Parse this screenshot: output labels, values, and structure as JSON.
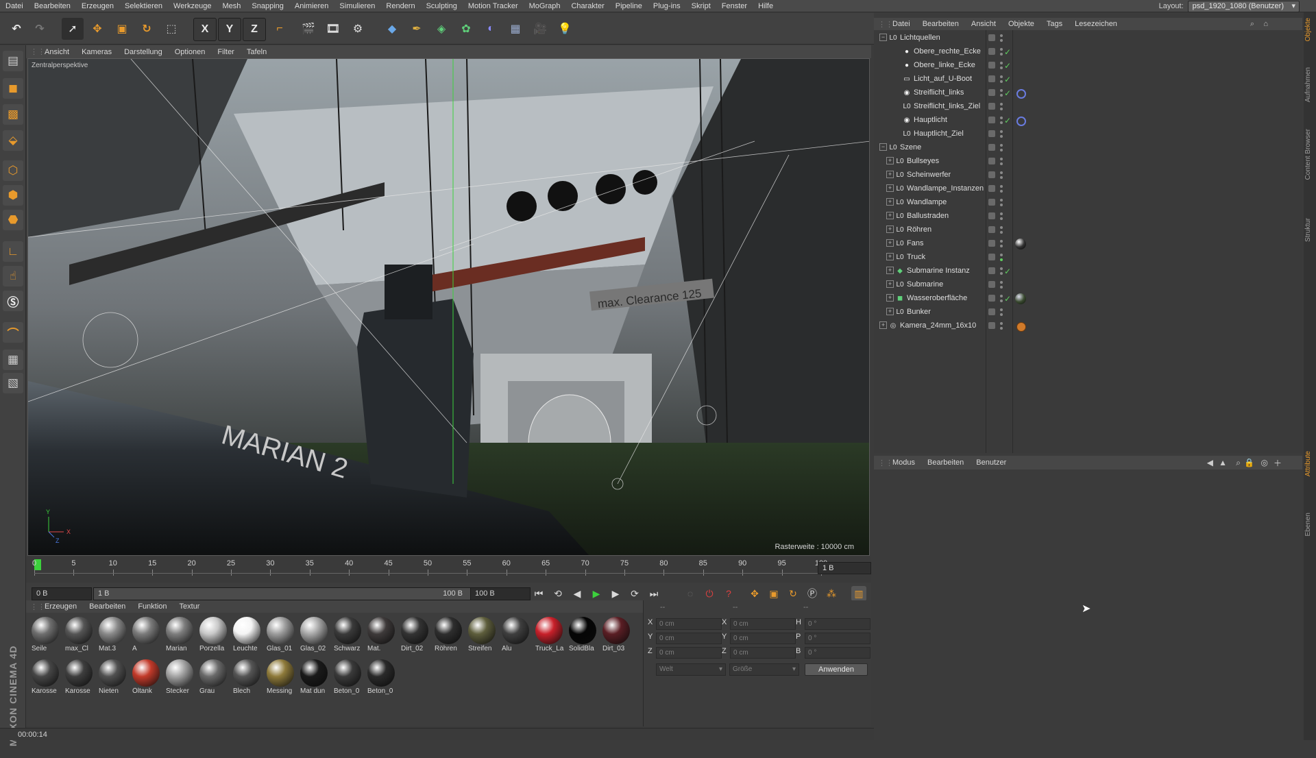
{
  "menubar": {
    "items": [
      "Datei",
      "Bearbeiten",
      "Erzeugen",
      "Selektieren",
      "Werkzeuge",
      "Mesh",
      "Snapping",
      "Animieren",
      "Simulieren",
      "Rendern",
      "Sculpting",
      "Motion Tracker",
      "MoGraph",
      "Charakter",
      "Pipeline",
      "Plug-ins",
      "Skript",
      "Fenster",
      "Hilfe"
    ],
    "layout_label": "Layout:",
    "layout_value": "psd_1920_1080 (Benutzer)"
  },
  "toolbar": {
    "axis_x": "X",
    "axis_y": "Y",
    "axis_z": "Z",
    "icons": [
      "undo-icon",
      "redo-icon",
      "select-icon",
      "move-icon",
      "scale-icon",
      "rotate-icon",
      "live-select-icon",
      "axis-x",
      "axis-y",
      "axis-z",
      "coord-system-icon",
      "render-view-icon",
      "render-picture-queue-icon",
      "render-settings-icon",
      "cube-icon",
      "pen-icon",
      "subdivision-icon",
      "cloner-icon",
      "deformer-icon",
      "floor-icon",
      "camera-icon",
      "light-icon"
    ]
  },
  "viewport": {
    "menu": [
      "Ansicht",
      "Kameras",
      "Darstellung",
      "Optionen",
      "Filter",
      "Tafeln"
    ],
    "camera_label": "Zentralperspektive",
    "grid_label": "Rasterweite : 10000 cm",
    "scene_text": "MARIAN 2",
    "sign_text": "max. Clearance 125",
    "axis": {
      "x": "X",
      "y": "Y",
      "z": "Z"
    }
  },
  "timeline": {
    "ticks": [
      "0",
      "5",
      "10",
      "15",
      "20",
      "25",
      "30",
      "35",
      "40",
      "45",
      "50",
      "55",
      "60",
      "65",
      "70",
      "75",
      "80",
      "85",
      "90",
      "95",
      "100"
    ],
    "current_frame": "1 B"
  },
  "transport": {
    "start_field": "0 B",
    "range_start": "1 B",
    "range_end": "100 B",
    "end_field": "100 B"
  },
  "materials": {
    "menu": [
      "Erzeugen",
      "Bearbeiten",
      "Funktion",
      "Textur"
    ],
    "row1": [
      {
        "name": "Seile",
        "color": "#6f6f6f"
      },
      {
        "name": "max_Cl",
        "color": "#555555"
      },
      {
        "name": "Mat.3",
        "color": "#8a8a8a"
      },
      {
        "name": "A",
        "color": "#7b7b7b"
      },
      {
        "name": "Marian",
        "color": "#7d7d7d"
      },
      {
        "name": "Porzella",
        "color": "#c9c9c9"
      },
      {
        "name": "Leuchte",
        "color": "#f4f4f4"
      },
      {
        "name": "Glas_01",
        "color": "#9c9c9c"
      },
      {
        "name": "Glas_02",
        "color": "#a8a8a8"
      },
      {
        "name": "Schwarz",
        "color": "#3a3a3a"
      },
      {
        "name": "Mat.",
        "color": "#3e3a3a"
      },
      {
        "name": "Dirt_02",
        "color": "#333333"
      },
      {
        "name": "Röhren",
        "color": "#2e2e2e"
      },
      {
        "name": "Streifen",
        "color": "#5e5e3c"
      },
      {
        "name": "Alu",
        "color": "#3f3f3f"
      },
      {
        "name": "Truck_La",
        "color": "#c8202a"
      },
      {
        "name": "SolidBla",
        "color": "#050505"
      },
      {
        "name": "Dirt_03",
        "color": "#5a1e24"
      }
    ],
    "row2": [
      {
        "name": "Karosse",
        "color": "#464646"
      },
      {
        "name": "Karosse",
        "color": "#3e3e3e"
      },
      {
        "name": "Nieten",
        "color": "#505050"
      },
      {
        "name": "Öltank",
        "color": "#c23a2a"
      },
      {
        "name": "Stecker",
        "color": "#a4a4a4"
      },
      {
        "name": "Grau",
        "color": "#6a6a6a"
      },
      {
        "name": "Blech",
        "color": "#555555"
      },
      {
        "name": "Messing",
        "color": "#8e7a3a"
      },
      {
        "name": "Mat dun",
        "color": "#1a1a1a"
      },
      {
        "name": "Beton_0",
        "color": "#3a3a3a"
      },
      {
        "name": "Beton_0",
        "color": "#2a2a2a"
      }
    ]
  },
  "coordinates": {
    "header": [
      "--",
      "--",
      "--"
    ],
    "rows": [
      {
        "l1": "X",
        "v1": "0 cm",
        "l2": "X",
        "v2": "0 cm",
        "l3": "H",
        "v3": "0 °"
      },
      {
        "l1": "Y",
        "v1": "0 cm",
        "l2": "Y",
        "v2": "0 cm",
        "l3": "P",
        "v3": "0 °"
      },
      {
        "l1": "Z",
        "v1": "0 cm",
        "l2": "Z",
        "v2": "0 cm",
        "l3": "B",
        "v3": "0 °"
      }
    ],
    "mode1": "Welt",
    "mode2": "Größe",
    "apply_label": "Anwenden"
  },
  "status": {
    "time": "00:00:14"
  },
  "object_manager": {
    "menu": [
      "Datei",
      "Bearbeiten",
      "Ansicht",
      "Objekte",
      "Tags",
      "Lesezeichen"
    ],
    "objects": [
      {
        "name": "Lichtquellen",
        "indent": 0,
        "expanded": true,
        "icon": "null-icon",
        "check": false,
        "tag": ""
      },
      {
        "name": "Obere_rechte_Ecke",
        "indent": 2,
        "expanded": false,
        "icon": "light-icon",
        "check": true,
        "tag": ""
      },
      {
        "name": "Obere_linke_Ecke",
        "indent": 2,
        "expanded": false,
        "icon": "light-icon",
        "check": true,
        "tag": ""
      },
      {
        "name": "Licht_auf_U-Boot",
        "indent": 2,
        "expanded": false,
        "icon": "area-light-icon",
        "check": true,
        "tag": ""
      },
      {
        "name": "Streiflicht_links",
        "indent": 2,
        "expanded": false,
        "icon": "spot-light-icon",
        "check": true,
        "tag": "target"
      },
      {
        "name": "Streiflicht_links_Ziel",
        "indent": 2,
        "expanded": false,
        "icon": "null-icon",
        "check": false,
        "tag": ""
      },
      {
        "name": "Hauptlicht",
        "indent": 2,
        "expanded": false,
        "icon": "spot-light-icon",
        "check": true,
        "tag": "target"
      },
      {
        "name": "Hauptlicht_Ziel",
        "indent": 2,
        "expanded": false,
        "icon": "null-icon",
        "check": false,
        "tag": ""
      },
      {
        "name": "Szene",
        "indent": 0,
        "expanded": true,
        "icon": "null-icon",
        "check": false,
        "tag": ""
      },
      {
        "name": "Bullseyes",
        "indent": 1,
        "expanded": false,
        "icon": "null-icon",
        "check": false,
        "tag": ""
      },
      {
        "name": "Scheinwerfer",
        "indent": 1,
        "expanded": false,
        "icon": "null-icon",
        "check": false,
        "tag": ""
      },
      {
        "name": "Wandlampe_Instanzen",
        "indent": 1,
        "expanded": false,
        "icon": "null-icon",
        "check": false,
        "tag": ""
      },
      {
        "name": "Wandlampe",
        "indent": 1,
        "expanded": false,
        "icon": "null-icon",
        "check": false,
        "tag": ""
      },
      {
        "name": "Ballustraden",
        "indent": 1,
        "expanded": false,
        "icon": "null-icon",
        "check": false,
        "tag": ""
      },
      {
        "name": "Röhren",
        "indent": 1,
        "expanded": false,
        "icon": "null-icon",
        "check": false,
        "tag": ""
      },
      {
        "name": "Fans",
        "indent": 1,
        "expanded": false,
        "icon": "null-icon",
        "check": false,
        "tag": "material"
      },
      {
        "name": "Truck",
        "indent": 1,
        "expanded": false,
        "icon": "null-icon",
        "check": false,
        "tag": "green-dot"
      },
      {
        "name": "Submarine Instanz",
        "indent": 1,
        "expanded": false,
        "icon": "instance-icon",
        "check": true,
        "tag": ""
      },
      {
        "name": "Submarine",
        "indent": 1,
        "expanded": false,
        "icon": "null-icon",
        "check": false,
        "tag": ""
      },
      {
        "name": "Wasseroberfläche",
        "indent": 1,
        "expanded": false,
        "icon": "plane-icon",
        "check": true,
        "tag": "material-green"
      },
      {
        "name": "Bunker",
        "indent": 1,
        "expanded": false,
        "icon": "null-icon",
        "check": false,
        "tag": ""
      },
      {
        "name": "Kamera_24mm_16x10",
        "indent": 0,
        "expanded": false,
        "icon": "camera-icon",
        "check": false,
        "tag": "protection"
      }
    ]
  },
  "attribute_manager": {
    "menu": [
      "Modus",
      "Bearbeiten",
      "Benutzer"
    ]
  },
  "right_tabs": [
    "Objekte",
    "Aufnahmen",
    "Content Browser",
    "Struktur",
    "Attribute",
    "Ebenen"
  ],
  "colors": {
    "accent": "#e89a2c",
    "check": "#5ecc5e",
    "panel_bg": "#3a3a3a"
  }
}
